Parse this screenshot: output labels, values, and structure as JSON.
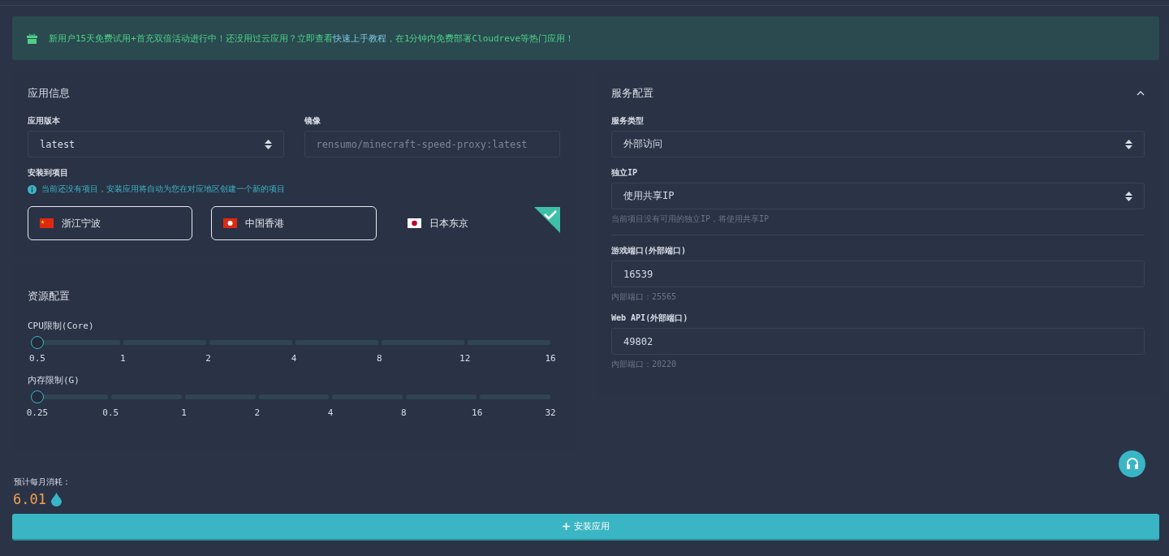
{
  "banner": {
    "text_before": "新用户15天免费试用+首充双倍活动进行中！还没用过云应用？立即查看",
    "link": "快速上手教程",
    "text_after": "，在1分钟内免费部署Cloudreve等热门应用！"
  },
  "app_info": {
    "title": "应用信息",
    "version": {
      "label": "应用版本",
      "value": "latest"
    },
    "image": {
      "label": "镜像",
      "value": "rensumo/minecraft-speed-proxy:latest",
      "disabled": true
    },
    "project": {
      "label": "安装到项目",
      "notice": "当前还没有项目，安装应用将自动为您在对应地区创建一个新的项目",
      "regions": [
        {
          "name": "浙江宁波",
          "kind": "cn",
          "selected": false
        },
        {
          "name": "中国香港",
          "kind": "hk",
          "selected": false
        },
        {
          "name": "日本东京",
          "kind": "jp",
          "selected": true
        }
      ]
    }
  },
  "resources": {
    "title": "资源配置",
    "sliders": [
      {
        "label": "CPU限制(Core)",
        "level": 0,
        "ticks": [
          "0.5",
          "1",
          "2",
          "4",
          "8",
          "12",
          "16"
        ]
      },
      {
        "label": "内存限制(G)",
        "level": 0,
        "ticks": [
          "0.25",
          "0.5",
          "1",
          "2",
          "4",
          "8",
          "16",
          "32"
        ]
      }
    ]
  },
  "service": {
    "title": "服务配置",
    "expanded": true,
    "fields": [
      {
        "kind": "select",
        "label": "服务类型",
        "value": "外部访问"
      },
      {
        "kind": "select",
        "label": "独立IP",
        "value": "使用共享IP",
        "hint": "当前项目没有可用的独立IP，将使用共享IP"
      },
      {
        "kind": "input",
        "label": "游戏端口(外部端口)",
        "value": "16539",
        "hint": "内部端口：25565"
      },
      {
        "kind": "input",
        "label": "Web API(外部端口)",
        "value": "49802",
        "hint": "内部端口：20220"
      }
    ]
  },
  "footer": {
    "cost_label": "预计每月消耗：",
    "cost": "6.01",
    "install_button": "安装应用"
  }
}
